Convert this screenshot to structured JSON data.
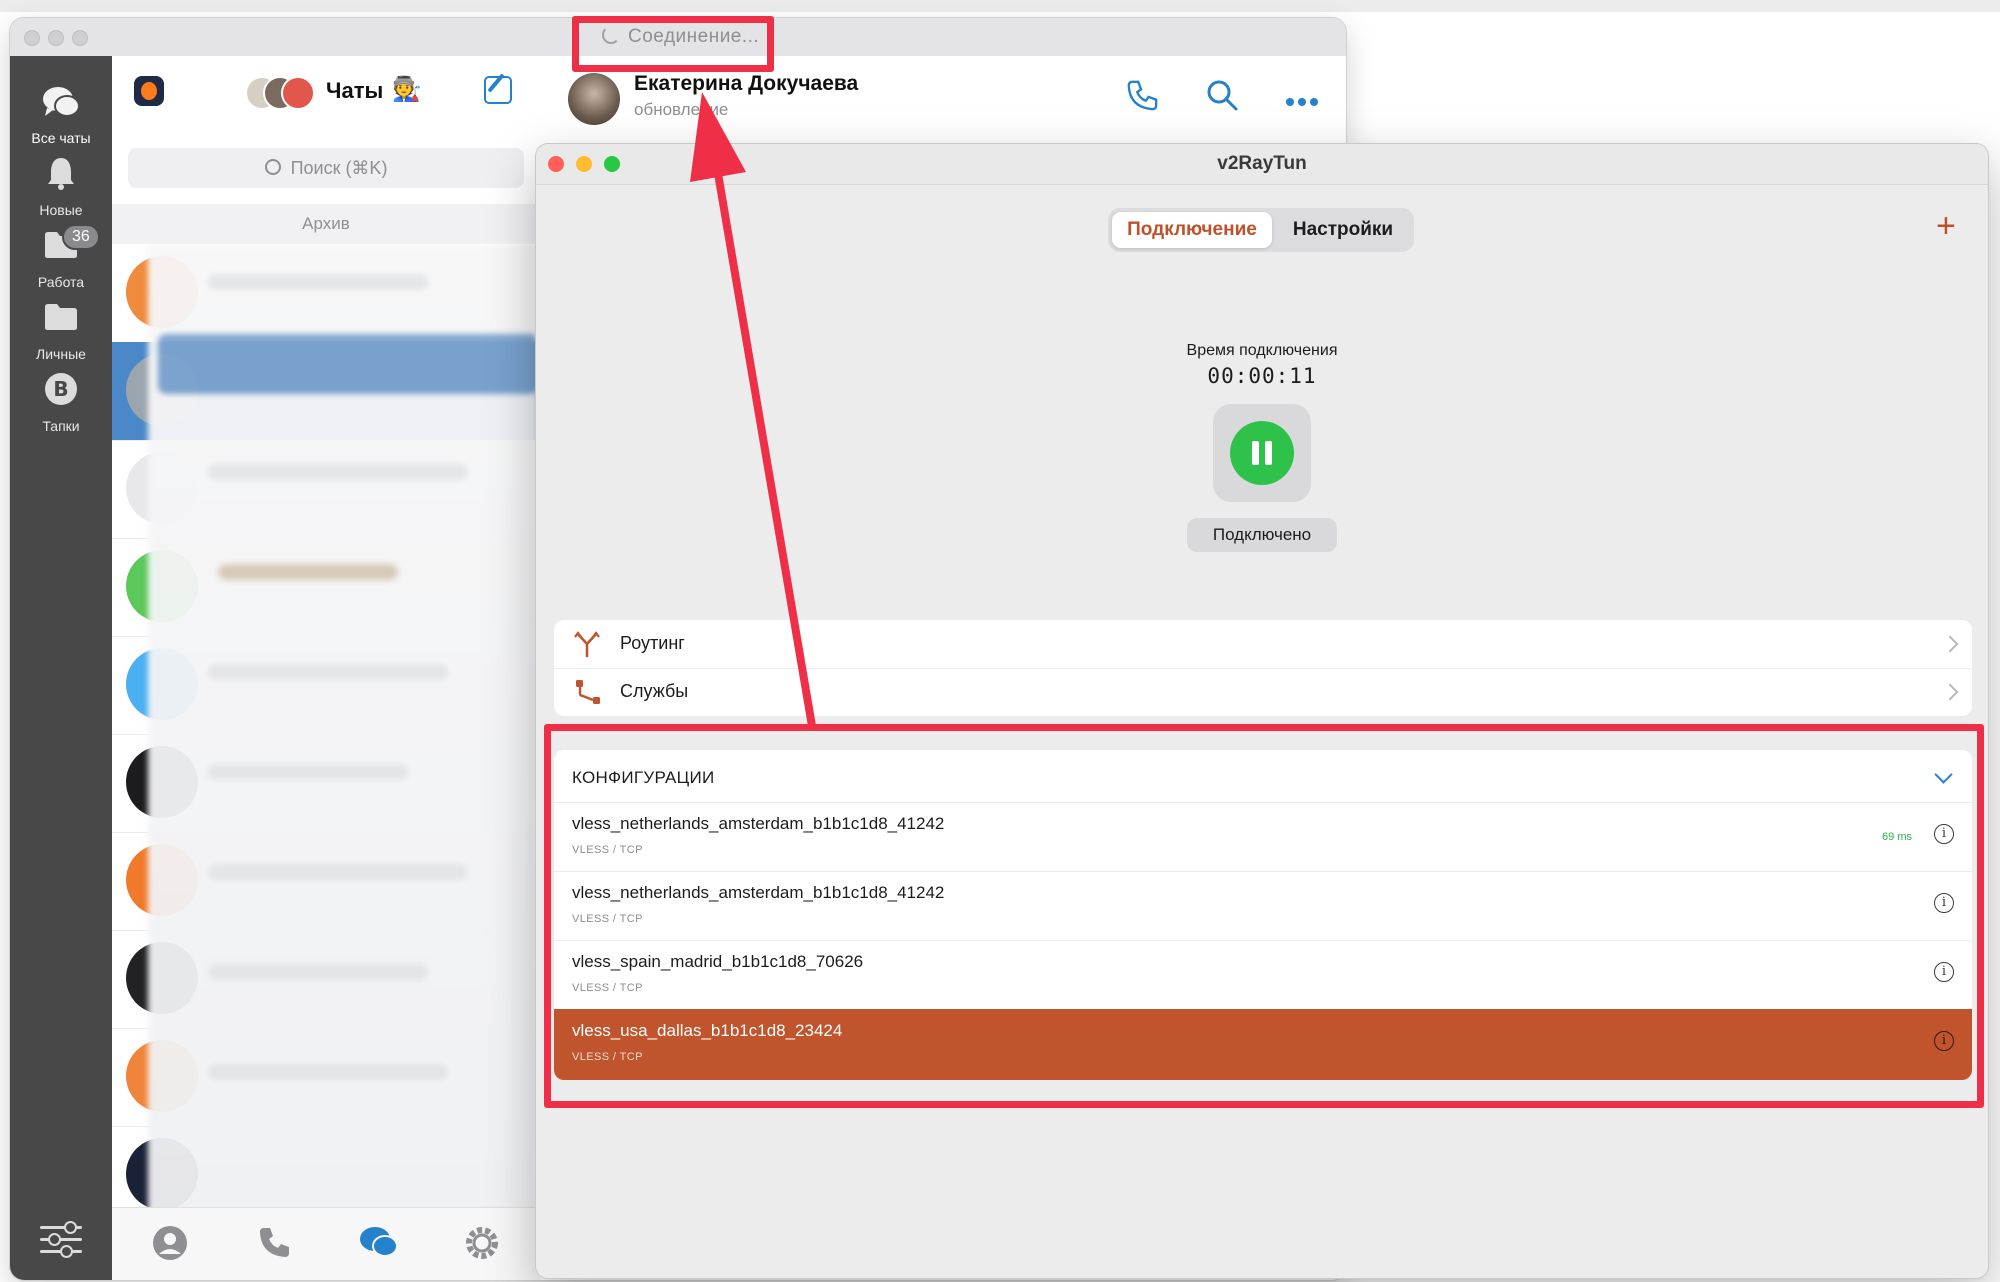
{
  "telegram": {
    "status_text": "Соединение...",
    "rail": [
      {
        "label": "Все чаты",
        "icon": "chats-icon"
      },
      {
        "label": "Новые",
        "icon": "bell-icon"
      },
      {
        "label": "Работа",
        "icon": "folder-icon",
        "badge": "36"
      },
      {
        "label": "Личные",
        "icon": "folder-icon"
      },
      {
        "label": "Тапки",
        "icon": "bitcoin-icon"
      }
    ],
    "header": {
      "title": "Чаты",
      "title_emoji": "🧑‍🏭"
    },
    "search_placeholder": "Поиск (⌘K)",
    "archive_label": "Архив",
    "chat": {
      "name": "Екатерина Докучаева",
      "status": "обновление"
    }
  },
  "v2raytun": {
    "window_title": "v2RayTun",
    "tabs": {
      "active": "Подключение",
      "inactive": "Настройки"
    },
    "add_symbol": "+",
    "time_label": "Время подключения",
    "time_value": "00:00:11",
    "status": "Подключено",
    "menu": [
      {
        "label": "Роутинг",
        "icon": "routing-icon"
      },
      {
        "label": "Службы",
        "icon": "services-icon"
      }
    ],
    "configs_header": "КОНФИГУРАЦИИ",
    "configs": [
      {
        "name": "vless_netherlands_amsterdam_b1b1c1d8_41242",
        "proto": "VLESS / TCP",
        "ping": "69 ms"
      },
      {
        "name": "vless_netherlands_amsterdam_b1b1c1d8_41242",
        "proto": "VLESS / TCP",
        "ping": ""
      },
      {
        "name": "vless_spain_madrid_b1b1c1d8_70626",
        "proto": "VLESS / TCP",
        "ping": ""
      },
      {
        "name": "vless_usa_dallas_b1b1c1d8_23424",
        "proto": "VLESS / TCP",
        "ping": ""
      }
    ],
    "selected_config_index": 3,
    "accent_color": "#c0542d",
    "connected_color": "#2ec24a"
  },
  "annotation_color": "#ee2f47"
}
